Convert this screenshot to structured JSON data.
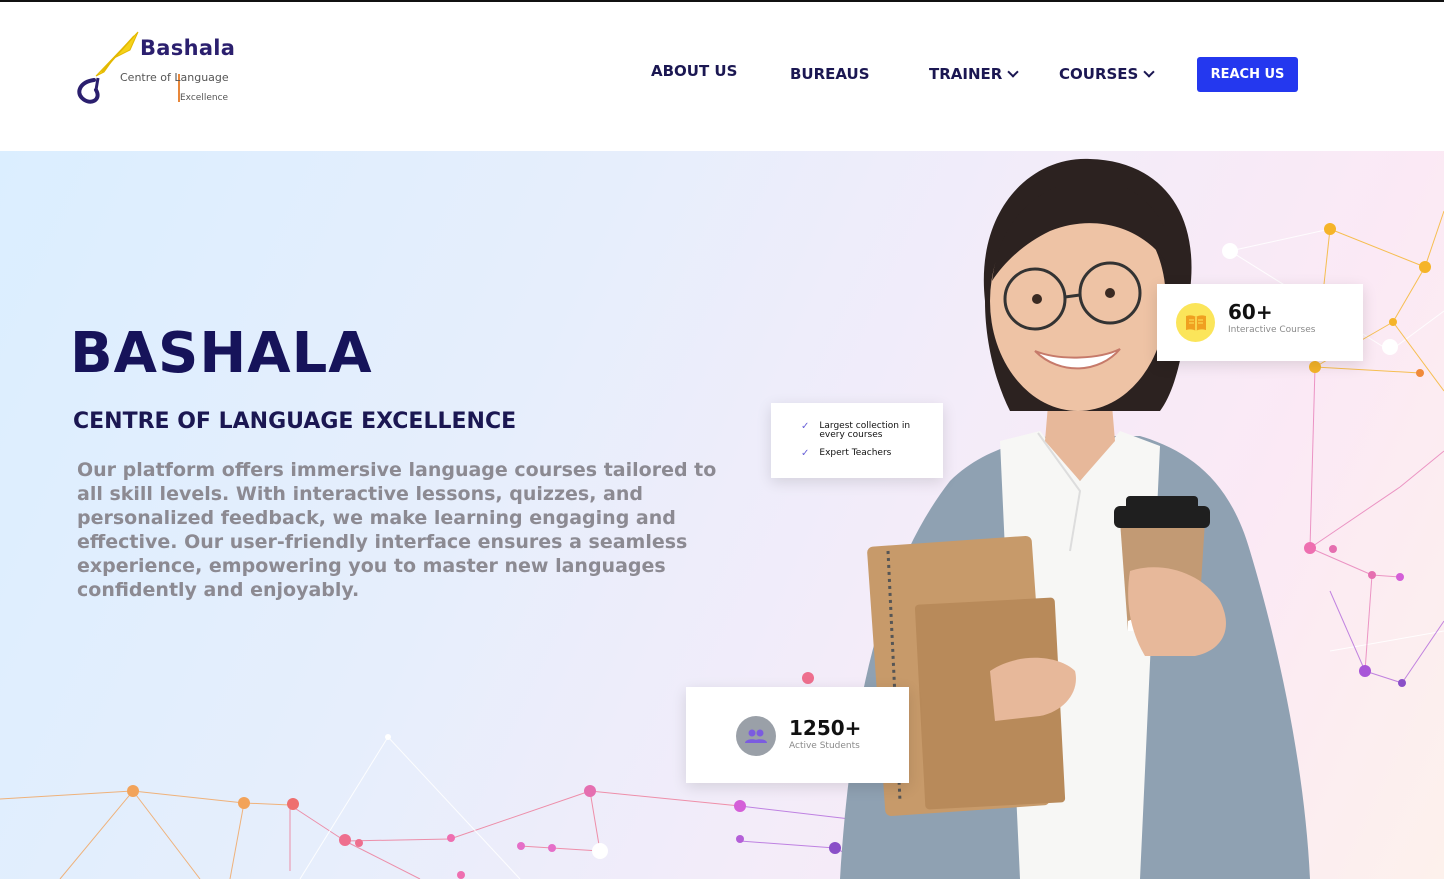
{
  "brand": {
    "name": "Bashala",
    "tagline_line1": "Centre of Language",
    "tagline_line2": "Excellence",
    "accent": "#2438ef",
    "navy": "#16135a"
  },
  "nav": {
    "items": [
      {
        "label": "ABOUT US"
      },
      {
        "label": "BUREAUS"
      },
      {
        "label": "TRAINER"
      },
      {
        "label": "COURSES"
      }
    ],
    "cta": "REACH US"
  },
  "hero": {
    "title": "BASHALA",
    "subtitle": "CENTRE OF LANGUAGE EXCELLENCE",
    "description": "Our platform offers immersive language courses tailored to all skill levels. With interactive lessons, quizzes, and personalized feedback, we make learning engaging and effective. Our user-friendly interface ensures a seamless experience, empowering you to master new languages confidently and enjoyably."
  },
  "stats": {
    "courses": {
      "value": "60+",
      "label": "Interactive Courses",
      "icon": "book-icon"
    },
    "students": {
      "value": "1250+",
      "label": "Active Students",
      "icon": "users-icon"
    }
  },
  "features": [
    {
      "text": "Largest collection in every courses"
    },
    {
      "text": "Expert Teachers"
    }
  ]
}
